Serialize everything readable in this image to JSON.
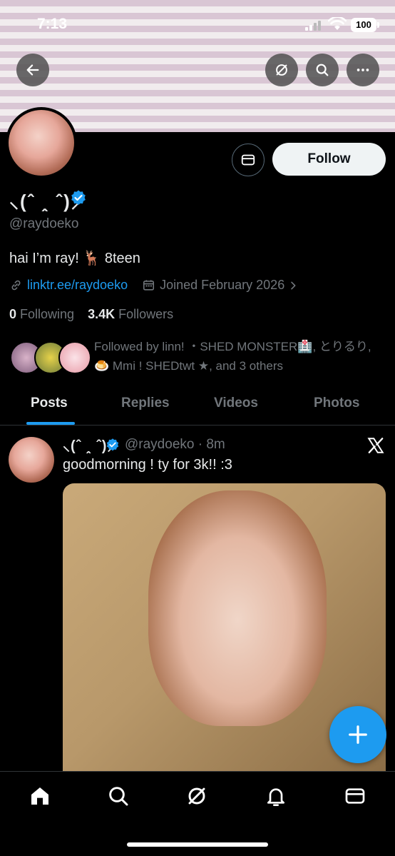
{
  "status_bar": {
    "time": "7:13",
    "battery": "100"
  },
  "profile": {
    "display_name": "⸜(ˆ ꞈ ˆ)⸝",
    "handle": "@raydoeko",
    "bio": "hai I’m ray! 🦌 8teen",
    "link": "linktr.ee/raydoeko",
    "joined": "Joined February 2026",
    "following_count": "0",
    "following_label": "Following",
    "followers_count": "3.4K",
    "followers_label": "Followers",
    "followed_by": "Followed by linn! ・SHED MONSTER🏥, とりるり, 🍮 Mmi ! SHEDtwt ★, and 3 others",
    "follow_label": "Follow"
  },
  "tabs": [
    {
      "label": "Posts",
      "active": true
    },
    {
      "label": "Replies",
      "active": false
    },
    {
      "label": "Videos",
      "active": false
    },
    {
      "label": "Photos",
      "active": false
    }
  ],
  "post": {
    "display_name": "⸜(ˆ ꞈ ˆ)⸝",
    "handle_time": "@raydoeko · 8m",
    "text": "goodmorning ! ty for 3k!! :3"
  },
  "icons": {
    "back": "back-arrow-icon",
    "grok": "grok-icon",
    "search": "search-icon",
    "more": "more-icon",
    "message": "envelope-icon",
    "link": "link-icon",
    "calendar": "calendar-icon",
    "fab": "plus-icon",
    "nav": [
      "home-icon",
      "search-icon",
      "grok-icon",
      "bell-icon",
      "envelope-icon"
    ]
  },
  "colors": {
    "accent": "#1d9bf0",
    "background": "#000000"
  }
}
